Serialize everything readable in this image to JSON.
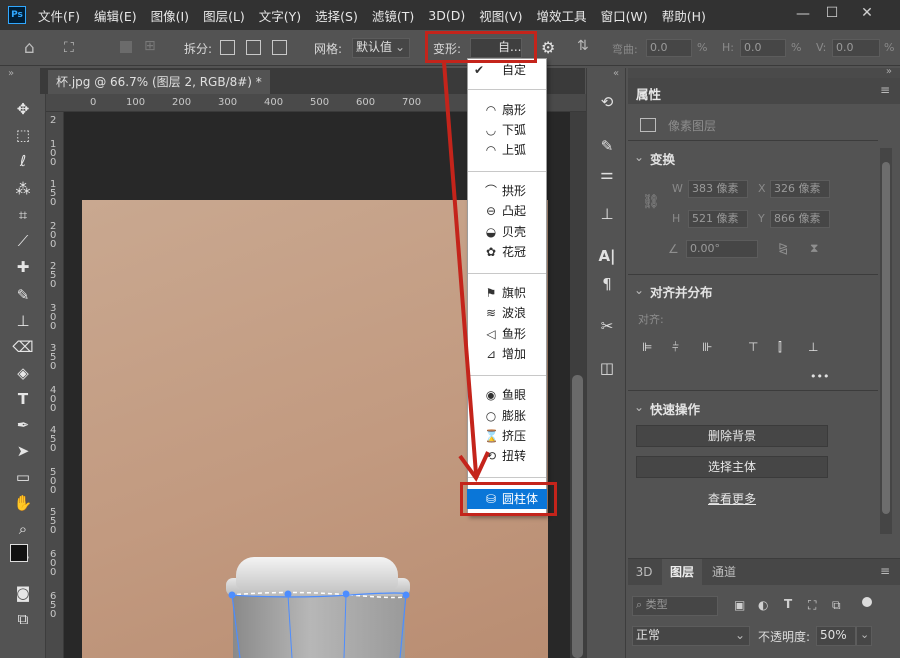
{
  "app": {
    "logo": "Ps"
  },
  "menu": [
    "文件(F)",
    "编辑(E)",
    "图像(I)",
    "图层(L)",
    "文字(Y)",
    "选择(S)",
    "滤镜(T)",
    "3D(D)",
    "视图(V)",
    "增效工具",
    "窗口(W)",
    "帮助(H)"
  ],
  "window_controls": {
    "minimize": "—",
    "maximize": "☐",
    "close": "✕"
  },
  "options": {
    "split_label": "拆分:",
    "grid_label": "网格:",
    "grid_value": "默认值",
    "warp_label": "变形:",
    "warp_value": "自...",
    "bend_label": "弯曲:",
    "bend_value": "0.0",
    "pct": "%",
    "h_label": "H:",
    "h_value": "0.0",
    "v_label": "V:",
    "v_value": "0.0"
  },
  "document_tab": {
    "title": "杯.jpg @ 66.7% (图层 2, RGB/8#) *",
    "close": "×"
  },
  "ruler": {
    "top": [
      "0",
      "100",
      "200",
      "300",
      "400",
      "500",
      "600",
      "700"
    ],
    "left": [
      "2",
      "100",
      "150",
      "200",
      "250",
      "300",
      "350",
      "400",
      "450",
      "500",
      "550",
      "600",
      "650"
    ]
  },
  "dropdown": {
    "items": [
      {
        "label": "自定",
        "icon": "checkmark-icon",
        "glyph": "✔"
      },
      {
        "label": "扇形",
        "icon": "arc-icon",
        "glyph": "◠"
      },
      {
        "label": "下弧",
        "icon": "arc-lower-icon",
        "glyph": "◡"
      },
      {
        "label": "上弧",
        "icon": "arc-upper-icon",
        "glyph": "◠"
      },
      {
        "label": "拱形",
        "icon": "arch-icon",
        "glyph": "⌒"
      },
      {
        "label": "凸起",
        "icon": "bulge-icon",
        "glyph": "⊖"
      },
      {
        "label": "贝壳",
        "icon": "shell-icon",
        "glyph": "◒"
      },
      {
        "label": "花冠",
        "icon": "flower-icon",
        "glyph": "✿"
      },
      {
        "label": "旗帜",
        "icon": "flag-icon",
        "glyph": "⚑"
      },
      {
        "label": "波浪",
        "icon": "wave-icon",
        "glyph": "≋"
      },
      {
        "label": "鱼形",
        "icon": "fish-icon",
        "glyph": "◁"
      },
      {
        "label": "增加",
        "icon": "rise-icon",
        "glyph": "⊿"
      },
      {
        "label": "鱼眼",
        "icon": "fisheye-icon",
        "glyph": "◉"
      },
      {
        "label": "膨胀",
        "icon": "inflate-icon",
        "glyph": "○"
      },
      {
        "label": "挤压",
        "icon": "squeeze-icon",
        "glyph": "⌛"
      },
      {
        "label": "扭转",
        "icon": "twist-icon",
        "glyph": "⟲"
      },
      {
        "label": "圆柱体",
        "icon": "cylinder-icon",
        "glyph": "⛁"
      }
    ]
  },
  "properties": {
    "tab_label": "属性",
    "pixel_layer": "像素图层",
    "transform": {
      "title": "变换",
      "w_label": "W",
      "w_value": "383 像素",
      "x_label": "X",
      "x_value": "326 像素",
      "h_label": "H",
      "h_value": "521 像素",
      "y_label": "Y",
      "y_value": "866 像素",
      "angle_value": "0.00°"
    },
    "align": {
      "title": "对齐并分布",
      "label": "对齐:",
      "more": "•••"
    },
    "quick": {
      "title": "快速操作",
      "remove_bg": "删除背景",
      "select_subject": "选择主体",
      "see_more": "查看更多"
    }
  },
  "layers": {
    "tabs": [
      "3D",
      "图层",
      "通道"
    ],
    "kind_label": "类型",
    "blend_mode": "正常",
    "opacity_label": "不透明度:",
    "opacity_value": "50%"
  },
  "colors": {
    "highlight": "#0a76d8",
    "annotation": "#c4241b",
    "menubar": "#323232",
    "panel": "#535353"
  }
}
